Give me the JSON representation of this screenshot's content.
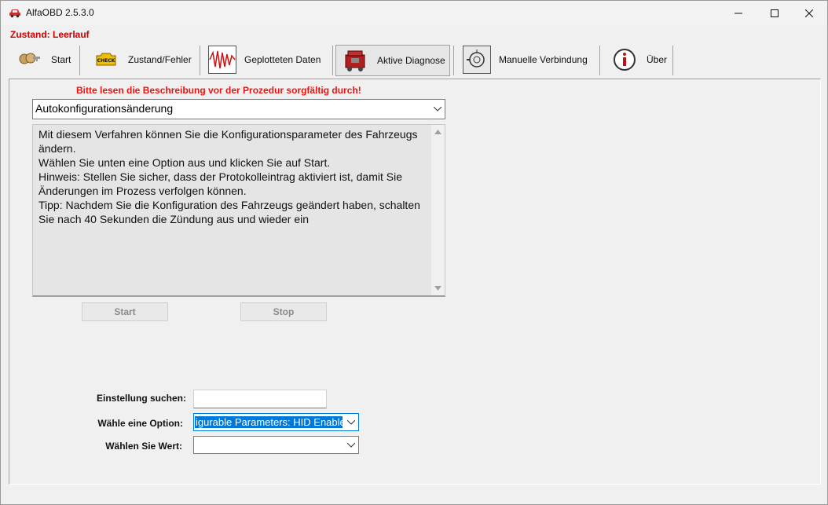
{
  "window": {
    "title": "AlfaOBD 2.5.3.0",
    "controls": {
      "minimize": "minimize-icon",
      "maximize": "maximize-icon",
      "close": "close-icon"
    }
  },
  "status": {
    "label": "Zustand: Leerlauf",
    "color": "#cc0000"
  },
  "toolbar": {
    "items": [
      {
        "label": "Start",
        "icon": "keys-icon"
      },
      {
        "label": "Zustand/Fehler",
        "icon": "check-engine-icon"
      },
      {
        "label": "Geplotteten Daten",
        "icon": "waveform-icon"
      },
      {
        "label": "Aktive Diagnose",
        "icon": "engine-icon",
        "active": true
      },
      {
        "label": "Manuelle Verbindung",
        "icon": "connection-icon"
      },
      {
        "label": "Über",
        "icon": "info-icon"
      }
    ]
  },
  "procedure": {
    "warning": "Bitte lesen die Beschreibung vor der Prozedur sorgfältig durch!",
    "selected": "Autokonfigurationsänderung",
    "description": "Mit diesem Verfahren können Sie die Konfigurationsparameter des Fahrzeugs ändern.\nWählen Sie unten eine Option aus und klicken Sie auf Start.\nHinweis: Stellen Sie sicher, dass der Protokolleintrag aktiviert ist, damit Sie Änderungen im Prozess verfolgen können.\nTipp: Nachdem Sie die Konfiguration des Fahrzeugs geändert haben, schalten Sie nach 40 Sekunden die Zündung aus und wieder ein",
    "start_label": "Start",
    "stop_label": "Stop"
  },
  "settings": {
    "search_label": "Einstellung suchen:",
    "search_value": "",
    "option_label": "Wähle eine Option:",
    "option_value": "igurable Parameters: HID Enable",
    "value_label": "Wählen Sie Wert:",
    "value_value": ""
  },
  "colors": {
    "accent": "#0078d7",
    "warning": "#ee1111"
  }
}
